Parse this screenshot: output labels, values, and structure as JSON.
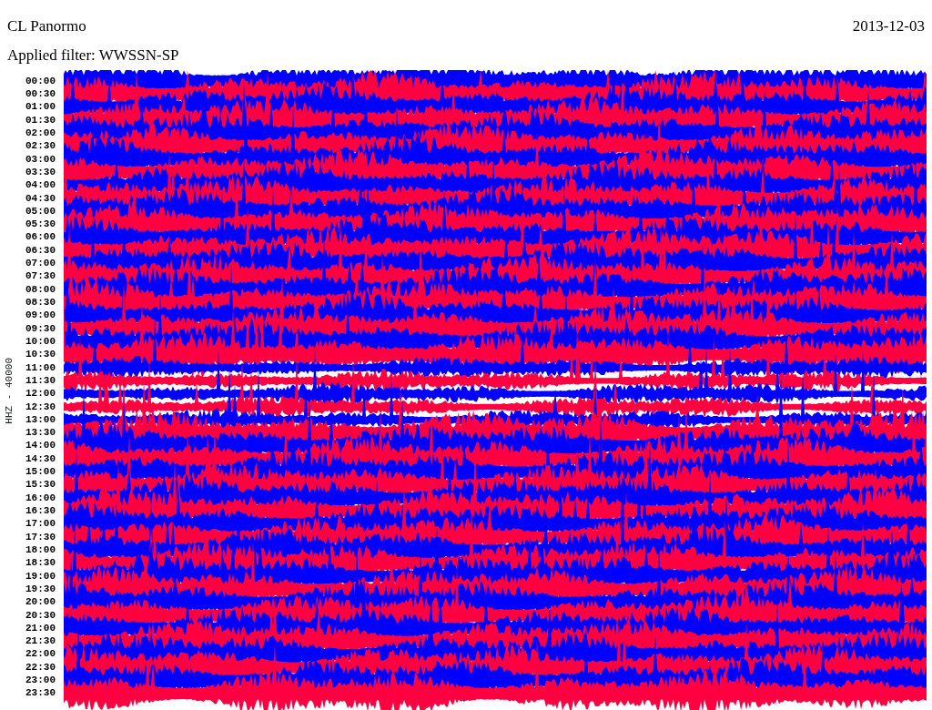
{
  "title": "CL Panormo",
  "date": "2013-12-03",
  "filter": "Applied filter: WWSSN-SP",
  "channel_label": "HHZ - 40000",
  "time_labels": [
    "00:00",
    "00:30",
    "01:00",
    "01:30",
    "02:00",
    "02:30",
    "03:00",
    "03:30",
    "04:00",
    "04:30",
    "05:00",
    "05:30",
    "06:00",
    "06:30",
    "07:00",
    "07:30",
    "08:00",
    "08:30",
    "09:00",
    "09:30",
    "10:00",
    "10:30",
    "11:00",
    "11:30",
    "12:00",
    "12:30",
    "13:00",
    "13:30",
    "14:00",
    "14:30",
    "15:00",
    "15:30",
    "16:00",
    "16:30",
    "17:00",
    "17:30",
    "18:00",
    "18:30",
    "19:00",
    "19:30",
    "20:00",
    "20:30",
    "21:00",
    "21:30",
    "22:00",
    "22:30",
    "23:00",
    "23:30"
  ]
}
